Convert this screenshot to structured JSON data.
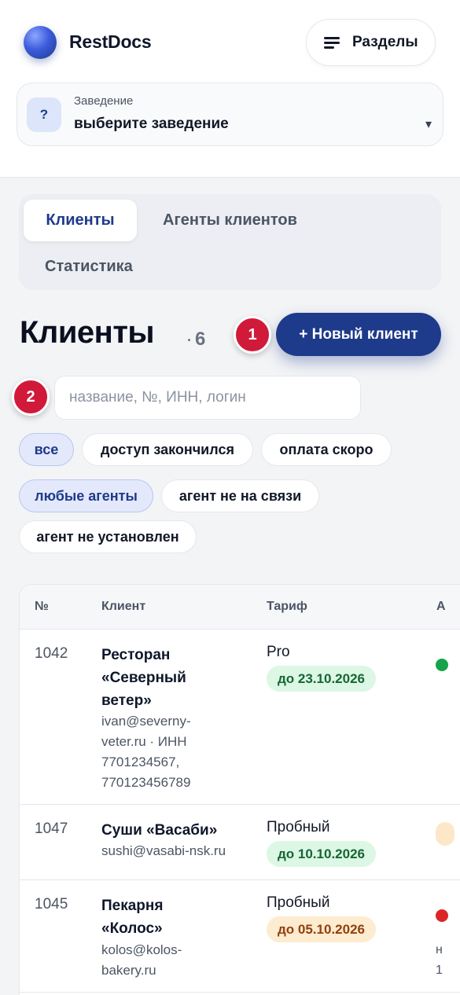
{
  "header": {
    "brand": "RestDocs",
    "sections_label": "Разделы",
    "venue": {
      "caption": "Заведение",
      "value": "выберите заведение",
      "icon_text": "?",
      "caret": "▾"
    }
  },
  "tabs": [
    {
      "label": "Клиенты",
      "active": true
    },
    {
      "label": "Агенты клиентов",
      "active": false
    },
    {
      "label": "Статистика",
      "active": false
    }
  ],
  "page": {
    "title": "Клиенты",
    "count_sep": "·",
    "count": "6",
    "new_client_label": "+ Новый клиент",
    "badges": [
      "1",
      "2"
    ]
  },
  "search": {
    "value": "",
    "placeholder": "название, №, ИНН, логин"
  },
  "filters": {
    "status": [
      {
        "label": "все",
        "active": true
      },
      {
        "label": "доступ закончился",
        "active": false
      },
      {
        "label": "оплата скоро",
        "active": false
      }
    ],
    "agents": [
      {
        "label": "любые агенты",
        "active": true
      },
      {
        "label": "агент не на связи",
        "active": false
      },
      {
        "label": "агент не установлен",
        "active": false
      }
    ]
  },
  "table": {
    "columns": [
      "№",
      "Клиент",
      "Тариф",
      "А"
    ],
    "rows": [
      {
        "num": "1042",
        "name_lines": [
          "Ресторан",
          "«Северный",
          "ветер»"
        ],
        "meta_lines": [
          "ivan@severny-",
          "veter.ru · ИНН",
          "7701234567,",
          "770123456789"
        ],
        "tariff": "Pro",
        "until": "до 23.10.2026",
        "until_tone": "green",
        "status_color": "#16a34a"
      },
      {
        "num": "1047",
        "name_lines": [
          "Суши «Васаби»"
        ],
        "meta_lines": [
          "sushi@vasabi-nsk.ru"
        ],
        "tariff": "Пробный",
        "until": "до 10.10.2026",
        "until_tone": "green",
        "status_color": "#fde7c8"
      },
      {
        "num": "1045",
        "name_lines": [
          "Пекарня",
          "«Колос»"
        ],
        "meta_lines": [
          "kolos@kolos-",
          "bakery.ru"
        ],
        "tariff": "Пробный",
        "until": "до 05.10.2026",
        "until_tone": "amber",
        "status_color": "#dc2626",
        "peek_lines": [
          "н",
          "1"
        ]
      }
    ]
  }
}
